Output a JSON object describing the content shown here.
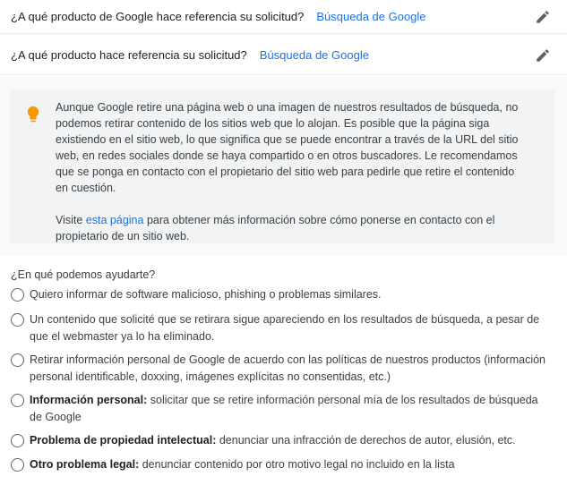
{
  "questions": [
    {
      "label": "¿A qué producto de Google hace referencia su solicitud?",
      "answer": "Búsqueda de Google"
    },
    {
      "label": "¿A qué producto hace referencia su solicitud?",
      "answer": "Búsqueda de Google"
    }
  ],
  "info": {
    "icon": "lightbulb-icon",
    "icon_color": "#f29900",
    "paragraph1": "Aunque Google retire una página web o una imagen de nuestros resultados de búsqueda, no podemos retirar contenido de los sitios web que lo alojan. Es posible que la página siga existiendo en el sitio web, lo que significa que se puede encontrar a través de la URL del sitio web, en redes sociales donde se haya compartido o en otros buscadores. Le recomendamos que se ponga en contacto con el propietario del sitio web para pedirle que retire el contenido en cuestión.",
    "paragraph2_before": "Visite ",
    "paragraph2_link": "esta página",
    "paragraph2_after": " para obtener más información sobre cómo ponerse en contacto con el propietario de un sitio web."
  },
  "help": {
    "title": "¿En qué podemos ayudarte?",
    "options": [
      {
        "bold": "",
        "text": "Quiero informar de software malicioso, phishing o problemas similares."
      },
      {
        "bold": "",
        "text": "Un contenido que solicité que se retirara sigue apareciendo en los resultados de búsqueda, a pesar de que el webmaster ya lo ha eliminado."
      },
      {
        "bold": "",
        "text": "Retirar información personal de Google de acuerdo con las políticas de nuestros productos (información personal identificable, doxxing, imágenes explícitas no consentidas, etc.)"
      },
      {
        "bold": "Información personal:",
        "text": " solicitar que se retire información personal mía de los resultados de búsqueda de Google"
      },
      {
        "bold": "Problema de propiedad intelectual:",
        "text": " denunciar una infracción de derechos de autor, elusión, etc."
      },
      {
        "bold": "Otro problema legal:",
        "text": " denunciar contenido por otro motivo legal no incluido en la lista"
      }
    ]
  },
  "colors": {
    "link": "#1a73e8",
    "radio_border": "#5f6368",
    "info_bg": "#f1f3f4"
  }
}
